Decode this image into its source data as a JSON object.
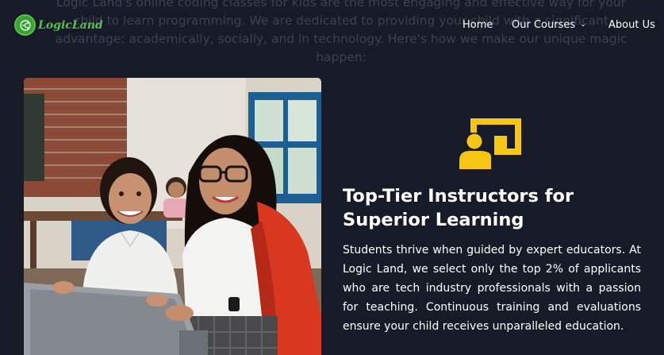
{
  "intro": {
    "text": "Logic Land's online coding classes for kids are the most engaging and effective way for your child to learn programming. We are dedicated to providing your child with a significant advantage: academically, socially, and in technology. Here's how we make our unique magic happen:"
  },
  "header": {
    "logo_text": "LogicLand",
    "logo_icon": "logic-land-logo-icon",
    "nav": {
      "home": "Home",
      "courses": "Our Courses",
      "about": "About Us"
    }
  },
  "feature": {
    "icon": "teacher-presentation-icon",
    "title": "Top-Tier Instructors for Superior Learning",
    "description": "Students thrive when guided by expert educators. At Logic Land, we select only the top 2% of applicants who are tech industry professionals with a passion for teaching. Continuous training and evaluations ensure your child receives unparalleled education."
  },
  "colors": {
    "background": "#161b27",
    "accent_yellow": "#f6c615",
    "logo_green": "#5cc04f",
    "text": "#ffffff"
  }
}
